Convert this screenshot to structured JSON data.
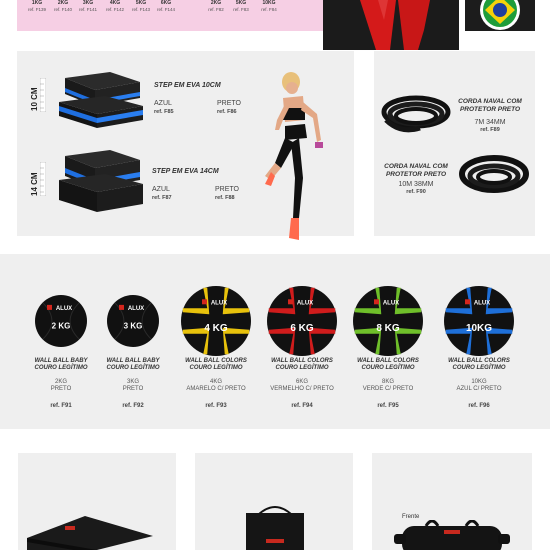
{
  "top": {
    "left_items": [
      {
        "weight": "1KG",
        "ref": "ref. F139"
      },
      {
        "weight": "2KG",
        "ref": "ref. F140"
      },
      {
        "weight": "3KG",
        "ref": "ref. F141"
      },
      {
        "weight": "4KG",
        "ref": "ref. F142"
      },
      {
        "weight": "5KG",
        "ref": "ref. F143"
      },
      {
        "weight": "6KG",
        "ref": "ref. F144"
      }
    ],
    "mid_items": [
      {
        "weight": "2KG",
        "ref": "ref. F82"
      },
      {
        "weight": "5KG",
        "ref": "ref. F83"
      },
      {
        "weight": "10KG",
        "ref": "ref. F84"
      }
    ]
  },
  "steps": {
    "step10": {
      "side_label": "10 CM",
      "title": "STEP EM EVA 10CM",
      "opt1": "AZUL",
      "ref1": "ref. F85",
      "opt2": "PRETO",
      "ref2": "ref. F86"
    },
    "step14": {
      "side_label": "14 CM",
      "title": "STEP EM EVA 14CM",
      "opt1": "AZUL",
      "ref1": "ref. F87",
      "opt2": "PRETO",
      "ref2": "ref. F88"
    }
  },
  "ropes": {
    "rope1": {
      "title_l1": "CORDA NAVAL COM",
      "title_l2": "PROTETOR PRETO",
      "size": "7M 34MM",
      "ref": "ref. F89"
    },
    "rope2": {
      "title_l1": "CORDA NAVAL COM",
      "title_l2": "PROTETOR PRETO",
      "size": "10M 38MM",
      "ref": "ref. F90"
    }
  },
  "wallballs": [
    {
      "ball_label": "2 KG",
      "t1": "WALL BALL BABY",
      "t2": "COURO LEGÍTIMO",
      "s1": "2KG",
      "s2": "PRETO",
      "ref": "ref. F91",
      "accent": "#111111",
      "logo": false
    },
    {
      "ball_label": "3 KG",
      "t1": "WALL BALL BABY",
      "t2": "COURO LEGÍTIMO",
      "s1": "3KG",
      "s2": "PRETO",
      "ref": "ref. F92",
      "accent": "#111111",
      "logo": false
    },
    {
      "ball_label": "4 KG",
      "t1": "WALL BALL COLORS",
      "t2": "COURO LEGÍTIMO",
      "s1": "4KG",
      "s2": "AMARELO C/ PRETO",
      "ref": "ref. F93",
      "accent": "#e8c20c",
      "logo": true
    },
    {
      "ball_label": "6 KG",
      "t1": "WALL BALL COLORS",
      "t2": "COURO LEGÍTIMO",
      "s1": "6KG",
      "s2": "VERMELHO C/ PRETO",
      "ref": "ref. F94",
      "accent": "#d01c1c",
      "logo": true
    },
    {
      "ball_label": "8 KG",
      "t1": "WALL BALL COLORS",
      "t2": "COURO LEGÍTIMO",
      "s1": "8KG",
      "s2": "VERDE C/ PRETO",
      "ref": "ref. F95",
      "accent": "#6fbf2a",
      "logo": true
    },
    {
      "ball_label": "10KG",
      "t1": "WALL BALL COLORS",
      "t2": "COURO LEGÍTIMO",
      "s1": "10KG",
      "s2": "AZUL C/ PRETO",
      "ref": "ref. F96",
      "accent": "#1e6fd8",
      "logo": true
    }
  ],
  "bottom": {
    "frente_label": "Frente"
  },
  "brand": "ALUX"
}
